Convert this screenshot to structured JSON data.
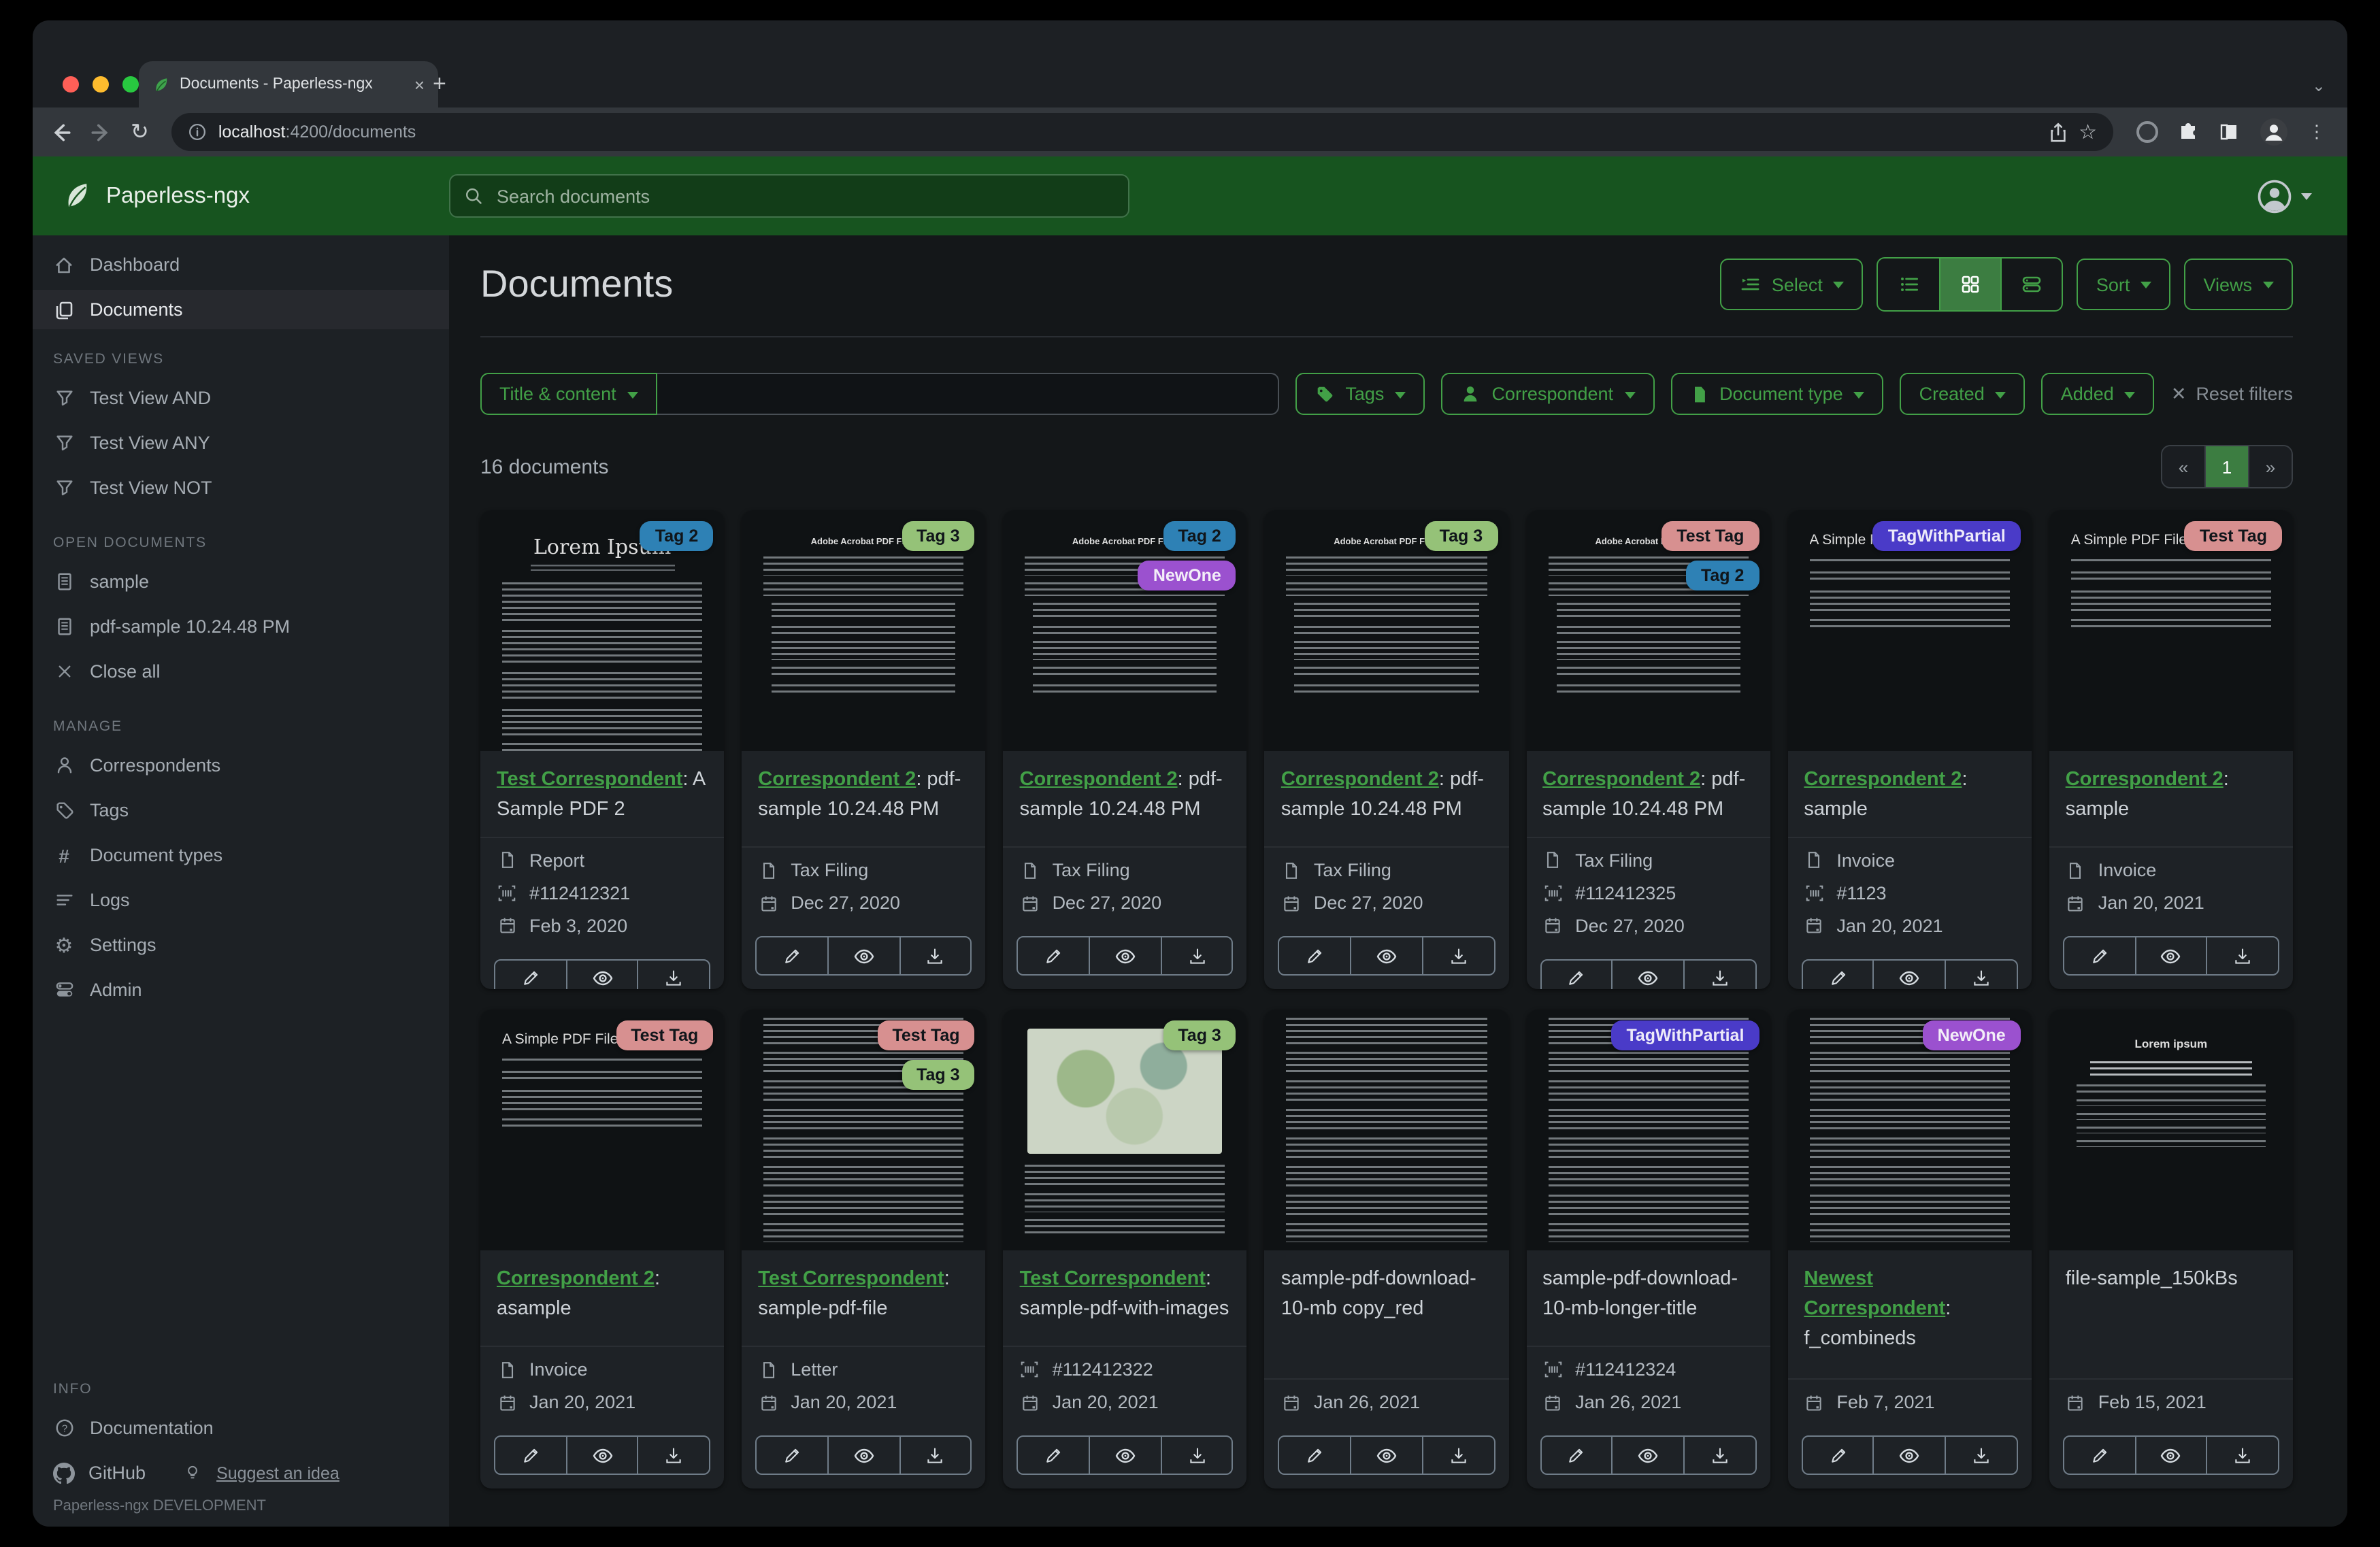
{
  "colors": {
    "accent": "#42a047",
    "header_green": "#17541f",
    "active_toggle": "#3c7d41"
  },
  "browser": {
    "tab_title": "Documents - Paperless-ngx",
    "close_tab": "×",
    "new_tab": "+",
    "window_chevron": "⌄",
    "reload": "↻",
    "star": "☆",
    "kebab": "⋮",
    "url_host": "localhost",
    "url_path": ":4200/documents"
  },
  "header": {
    "app_name": "Paperless-ngx",
    "search_placeholder": "Search documents"
  },
  "sidebar": {
    "dashboard": "Dashboard",
    "documents": "Documents",
    "saved_views_title": "SAVED VIEWS",
    "saved_views": [
      "Test View AND",
      "Test View ANY",
      "Test View NOT"
    ],
    "open_documents_title": "OPEN DOCUMENTS",
    "open_documents": [
      "sample",
      "pdf-sample 10.24.48 PM"
    ],
    "close_all": "Close all",
    "manage_title": "MANAGE",
    "manage": [
      "Correspondents",
      "Tags",
      "Document types",
      "Logs",
      "Settings",
      "Admin"
    ],
    "info_title": "INFO",
    "documentation": "Documentation",
    "github": "GitHub",
    "suggest": "Suggest an idea",
    "footer": "Paperless-ngx DEVELOPMENT"
  },
  "main": {
    "title": "Documents",
    "select_label": "Select",
    "sort_label": "Sort",
    "views_label": "Views",
    "filter_field": "Title & content",
    "filter_query": "",
    "filter_tags": "Tags",
    "filter_correspondent": "Correspondent",
    "filter_document_type": "Document type",
    "filter_created": "Created",
    "filter_added": "Added",
    "reset_filters": "Reset filters",
    "count": "16 documents",
    "pagination": {
      "prev": "«",
      "page": "1",
      "next": "»"
    }
  },
  "tag_styles": {
    "Tag 2": {
      "bg": "#2e81b5",
      "fg": "#10151a"
    },
    "Tag 3": {
      "bg": "#95c278",
      "fg": "#10151a"
    },
    "NewOne": {
      "bg": "#9b51cf",
      "fg": "#f3eef8"
    },
    "Test Tag": {
      "bg": "#d79090",
      "fg": "#10151a"
    },
    "TagWithPartial": {
      "bg": "#4a3bc8",
      "fg": "#edeaf9"
    }
  },
  "cards": [
    {
      "thumb": "serif",
      "thumb_heading": "Lorem Ipsum",
      "tags": [
        "Tag 2"
      ],
      "correspondent": "Test Correspondent",
      "title": "A Sample PDF 2",
      "doc_type": "Report",
      "asn": "#112412321",
      "date": "Feb 3, 2020"
    },
    {
      "thumb": "adobe",
      "thumb_heading": "Adobe Acrobat PDF Files",
      "tags": [
        "Tag 3"
      ],
      "correspondent": "Correspondent 2",
      "title": "pdf-sample 10.24.48 PM",
      "doc_type": "Tax Filing",
      "asn": null,
      "date": "Dec 27, 2020"
    },
    {
      "thumb": "adobe",
      "thumb_heading": "Adobe Acrobat PDF Files",
      "tags": [
        "Tag 2",
        "NewOne"
      ],
      "correspondent": "Correspondent 2",
      "title": "pdf-sample 10.24.48 PM",
      "doc_type": "Tax Filing",
      "asn": null,
      "date": "Dec 27, 2020"
    },
    {
      "thumb": "adobe",
      "thumb_heading": "Adobe Acrobat PDF Files",
      "tags": [
        "Tag 3"
      ],
      "correspondent": "Correspondent 2",
      "title": "pdf-sample 10.24.48 PM",
      "doc_type": "Tax Filing",
      "asn": null,
      "date": "Dec 27, 2020"
    },
    {
      "thumb": "adobe",
      "thumb_heading": "Adobe Acrobat PDF Files",
      "tags": [
        "Test Tag",
        "Tag 2"
      ],
      "correspondent": "Correspondent 2",
      "title": "pdf-sample 10.24.48 PM",
      "doc_type": "Tax Filing",
      "asn": "#112412325",
      "date": "Dec 27, 2020"
    },
    {
      "thumb": "simple",
      "thumb_heading": "A Simple PDF File",
      "tags": [
        "TagWithPartial"
      ],
      "correspondent": "Correspondent 2",
      "title": "sample",
      "doc_type": "Invoice",
      "asn": "#1123",
      "date": "Jan 20, 2021"
    },
    {
      "thumb": "simple",
      "thumb_heading": "A Simple PDF File",
      "tags": [
        "Test Tag"
      ],
      "correspondent": "Correspondent 2",
      "title": "sample",
      "doc_type": "Invoice",
      "asn": null,
      "date": "Jan 20, 2021"
    },
    {
      "thumb": "simple",
      "thumb_heading": "A Simple PDF File",
      "tags": [
        "Test Tag"
      ],
      "correspondent": "Correspondent 2",
      "title": "asample",
      "doc_type": "Invoice",
      "asn": null,
      "date": "Jan 20, 2021"
    },
    {
      "thumb": "dense",
      "thumb_heading": "",
      "tags": [
        "Test Tag",
        "Tag 3"
      ],
      "correspondent": "Test Correspondent",
      "title": "sample-pdf-file",
      "doc_type": "Letter",
      "asn": null,
      "date": "Jan 20, 2021"
    },
    {
      "thumb": "map",
      "thumb_heading": "",
      "tags": [
        "Tag 3"
      ],
      "correspondent": "Test Correspondent",
      "title": "sample-pdf-with-images",
      "doc_type": null,
      "asn": "#112412322",
      "date": "Jan 20, 2021"
    },
    {
      "thumb": "dense",
      "thumb_heading": "",
      "tags": [],
      "correspondent": null,
      "title": "sample-pdf-download-10-mb copy_red",
      "doc_type": null,
      "asn": null,
      "date": "Jan 26, 2021"
    },
    {
      "thumb": "dense",
      "thumb_heading": "",
      "tags": [
        "TagWithPartial"
      ],
      "correspondent": null,
      "title": "sample-pdf-download-10-mb-longer-title",
      "doc_type": null,
      "asn": "#112412324",
      "date": "Jan 26, 2021"
    },
    {
      "thumb": "dense",
      "thumb_heading": "",
      "tags": [
        "NewOne"
      ],
      "correspondent": "Newest Correspondent",
      "title": "f_combineds",
      "doc_type": null,
      "asn": null,
      "date": "Feb 7, 2021"
    },
    {
      "thumb": "center",
      "thumb_heading": "Lorem ipsum",
      "tags": [],
      "correspondent": null,
      "title": "file-sample_150kBs",
      "doc_type": null,
      "asn": null,
      "date": "Feb 15, 2021"
    }
  ]
}
